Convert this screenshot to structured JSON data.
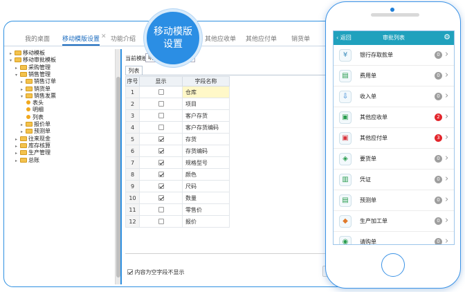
{
  "tabs": [
    {
      "label": "我的桌面"
    },
    {
      "label": "移动模版设置",
      "active": true
    },
    {
      "label": "功能介绍"
    },
    {
      "label": "其他应收单"
    },
    {
      "label": "其他应付单"
    },
    {
      "label": "销货单"
    }
  ],
  "tab_close": "✕",
  "callout": {
    "line1": "移动模版",
    "line2": "设置"
  },
  "tree": [
    {
      "label": "移动模板",
      "expanded": false
    },
    {
      "label": "移动审批模板",
      "expanded": true
    },
    {
      "label": "采购管理",
      "expanded": false
    },
    {
      "label": "销售管理",
      "expanded": true
    },
    {
      "label": "销售订单",
      "expanded": false
    },
    {
      "label": "销货单",
      "expanded": false
    },
    {
      "label": "销售发票",
      "expanded": true
    },
    {
      "label": "表头"
    },
    {
      "label": "明细"
    },
    {
      "label": "列表"
    },
    {
      "label": "报价单",
      "expanded": false
    },
    {
      "label": "预测单",
      "expanded": false
    },
    {
      "label": "往来现金",
      "expanded": false
    },
    {
      "label": "库存核算",
      "expanded": false
    },
    {
      "label": "生产管理",
      "expanded": false
    },
    {
      "label": "总账",
      "expanded": false
    }
  ],
  "template": {
    "label": "当前模板:",
    "value": "明细"
  },
  "list_tab": "列表",
  "grid": {
    "headers": [
      "序号",
      "显示",
      "字段名称"
    ],
    "rows": [
      {
        "no": "1",
        "checked": false,
        "field": "仓库",
        "selected": true
      },
      {
        "no": "2",
        "checked": false,
        "field": "项目"
      },
      {
        "no": "3",
        "checked": false,
        "field": "客户存货"
      },
      {
        "no": "4",
        "checked": false,
        "field": "客户存货编码"
      },
      {
        "no": "5",
        "checked": true,
        "field": "存货"
      },
      {
        "no": "6",
        "checked": true,
        "field": "存货编码"
      },
      {
        "no": "7",
        "checked": true,
        "field": "规格型号"
      },
      {
        "no": "8",
        "checked": true,
        "field": "颜色"
      },
      {
        "no": "9",
        "checked": true,
        "field": "尺码"
      },
      {
        "no": "10",
        "checked": true,
        "field": "数量"
      },
      {
        "no": "11",
        "checked": false,
        "field": "零售价"
      },
      {
        "no": "12",
        "checked": false,
        "field": "报价"
      }
    ]
  },
  "option": {
    "label": "内容为空字段不显示",
    "checked": true
  },
  "phone": {
    "back": "返回",
    "title": "审批列表",
    "gear": "⚙",
    "chevron": "›",
    "items": [
      {
        "label": "银行存取款单",
        "badge": "0",
        "icon": "¥",
        "icon_name": "bank-icon",
        "color": "#3c8dbc"
      },
      {
        "label": "费用单",
        "badge": "0",
        "icon": "▤",
        "icon_name": "expense-icon",
        "color": "#2a9d4f"
      },
      {
        "label": "收入单",
        "badge": "0",
        "icon": "⇩",
        "icon_name": "income-icon",
        "color": "#2c7fd1"
      },
      {
        "label": "其他应收单",
        "badge": "2",
        "badge_red": true,
        "icon": "▣",
        "icon_name": "receivable-icon",
        "color": "#2a9d4f"
      },
      {
        "label": "其他应付单",
        "badge": "3",
        "badge_red": true,
        "icon": "▣",
        "icon_name": "payable-icon",
        "color": "#d9363e"
      },
      {
        "label": "要货单",
        "badge": "0",
        "icon": "◈",
        "icon_name": "requisition-icon",
        "color": "#2a9d4f"
      },
      {
        "label": "凭证",
        "badge": "0",
        "icon": "▥",
        "icon_name": "voucher-icon",
        "color": "#2a9d4f"
      },
      {
        "label": "预测单",
        "badge": "0",
        "icon": "▤",
        "icon_name": "forecast-icon",
        "color": "#2a9d4f"
      },
      {
        "label": "生产加工单",
        "badge": "0",
        "icon": "◆",
        "icon_name": "production-icon",
        "color": "#e07a2b"
      },
      {
        "label": "请购单",
        "badge": "0",
        "icon": "◉",
        "icon_name": "purchase-request-icon",
        "color": "#2a9d4f"
      }
    ]
  }
}
